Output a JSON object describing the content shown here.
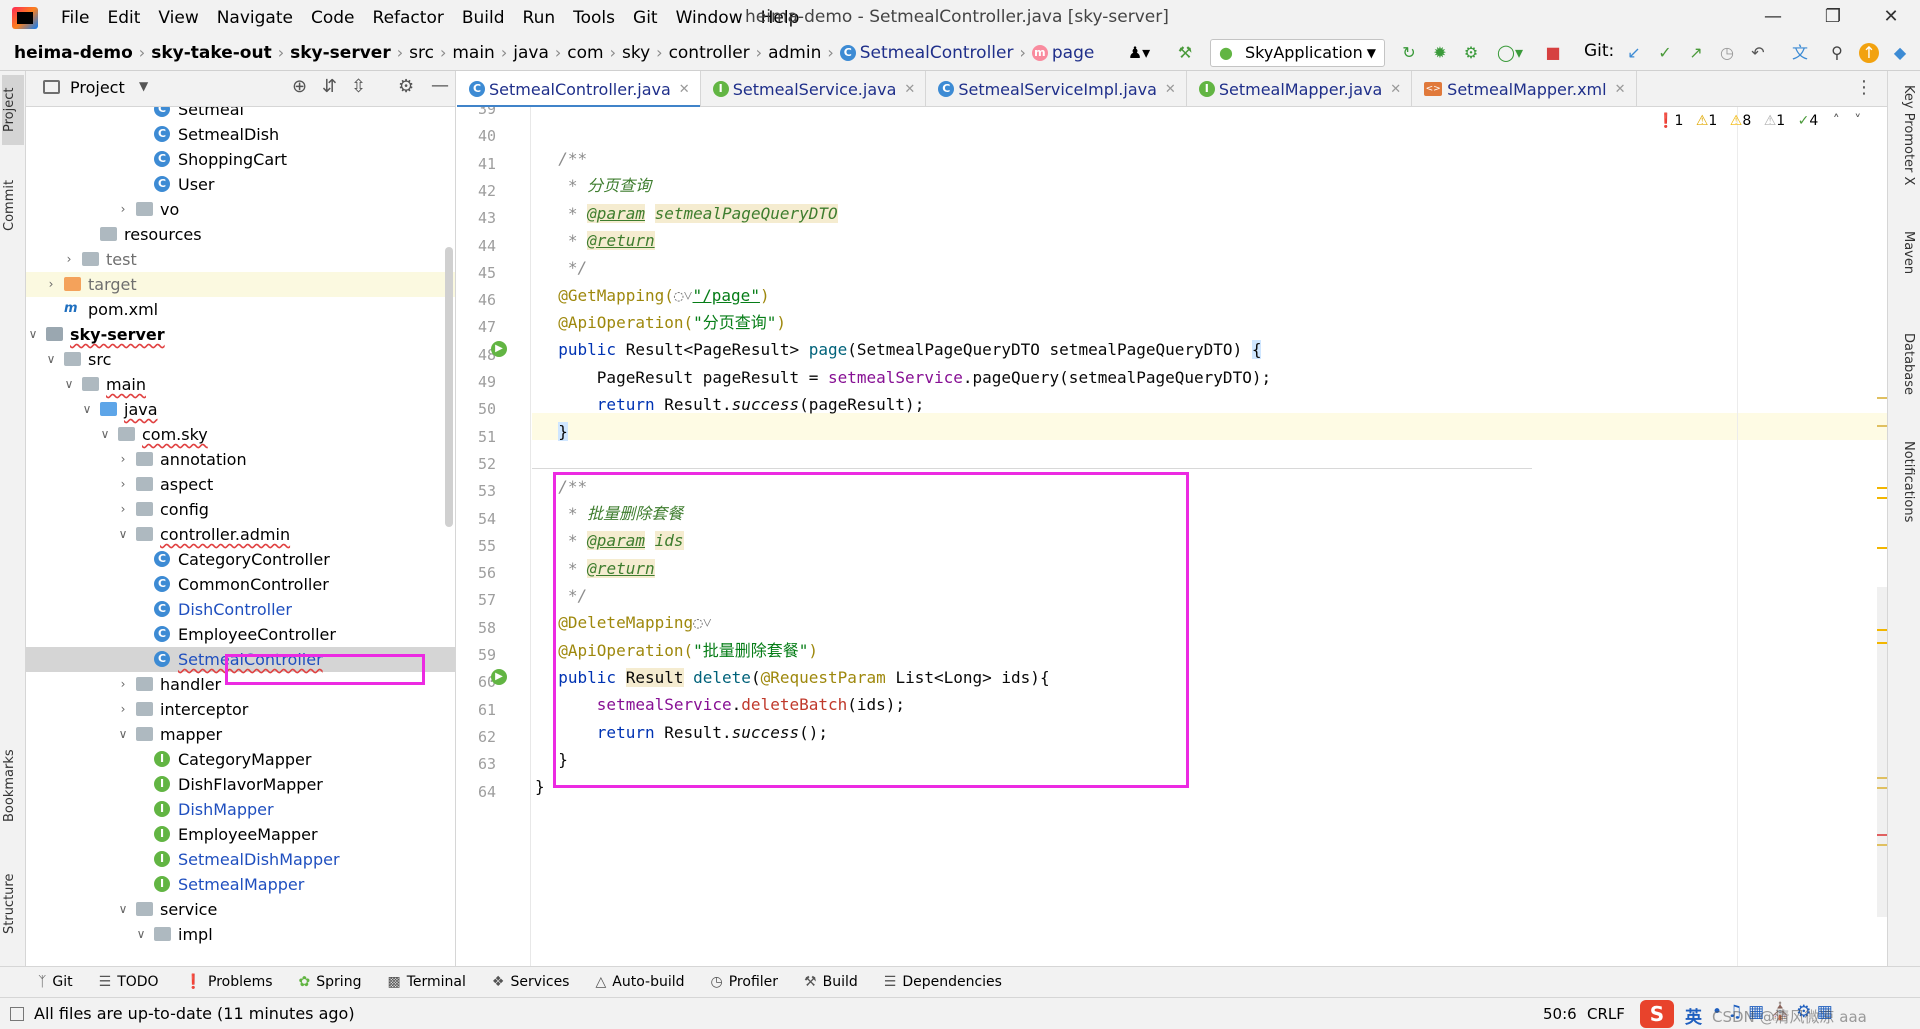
{
  "menu": [
    "File",
    "Edit",
    "View",
    "Navigate",
    "Code",
    "Refactor",
    "Build",
    "Run",
    "Tools",
    "Git",
    "Window",
    "Help"
  ],
  "window_title": "heima-demo - SetmealController.java [sky-server]",
  "breadcrumb": [
    "heima-demo",
    "sky-take-out",
    "sky-server",
    "src",
    "main",
    "java",
    "com",
    "sky",
    "controller",
    "admin",
    "SetmealController",
    "page"
  ],
  "run_config": "SkyApplication",
  "git_label": "Git:",
  "project_panel": {
    "title": "Project"
  },
  "tree": [
    {
      "label": "Setmeal",
      "icon": "class-icon",
      "depth": 9
    },
    {
      "label": "SetmealDish",
      "icon": "class-icon",
      "depth": 9
    },
    {
      "label": "ShoppingCart",
      "icon": "class-icon",
      "depth": 9
    },
    {
      "label": "User",
      "icon": "class-icon",
      "depth": 9
    },
    {
      "label": "vo",
      "icon": "package-icon",
      "depth": 8,
      "arrow": "right"
    },
    {
      "label": "resources",
      "icon": "folder-icon",
      "depth": 6
    },
    {
      "label": "test",
      "icon": "folder-icon",
      "depth": 5,
      "arrow": "right",
      "color": "gray"
    },
    {
      "label": "target",
      "icon": "folder-orange-icon",
      "depth": 4,
      "arrow": "right",
      "color": "gray",
      "hl": true
    },
    {
      "label": "pom.xml",
      "icon": "maven-icon",
      "depth": 4
    },
    {
      "label": "sky-server",
      "icon": "module-icon",
      "depth": 3,
      "arrow": "down",
      "bold": true,
      "squiggle": true
    },
    {
      "label": "src",
      "icon": "folder-icon",
      "depth": 4,
      "arrow": "down"
    },
    {
      "label": "main",
      "icon": "folder-icon",
      "depth": 5,
      "arrow": "down",
      "squiggle": true
    },
    {
      "label": "java",
      "icon": "folder-blue-icon",
      "depth": 6,
      "arrow": "down",
      "squiggle": true
    },
    {
      "label": "com.sky",
      "icon": "package-icon",
      "depth": 7,
      "arrow": "down",
      "squiggle": true
    },
    {
      "label": "annotation",
      "icon": "package-icon",
      "depth": 8,
      "arrow": "right"
    },
    {
      "label": "aspect",
      "icon": "package-icon",
      "depth": 8,
      "arrow": "right"
    },
    {
      "label": "config",
      "icon": "package-icon",
      "depth": 8,
      "arrow": "right"
    },
    {
      "label": "controller.admin",
      "icon": "package-icon",
      "depth": 8,
      "arrow": "down",
      "squiggle": true
    },
    {
      "label": "CategoryController",
      "icon": "class-icon",
      "depth": 9
    },
    {
      "label": "CommonController",
      "icon": "class-icon",
      "depth": 9
    },
    {
      "label": "DishController",
      "icon": "class-icon",
      "depth": 9,
      "color": "blue"
    },
    {
      "label": "EmployeeController",
      "icon": "class-icon",
      "depth": 9
    },
    {
      "label": "SetmealController",
      "icon": "class-icon",
      "depth": 9,
      "color": "blue",
      "selected": true,
      "squiggle": true
    },
    {
      "label": "handler",
      "icon": "package-icon",
      "depth": 8,
      "arrow": "right"
    },
    {
      "label": "interceptor",
      "icon": "package-icon",
      "depth": 8,
      "arrow": "right"
    },
    {
      "label": "mapper",
      "icon": "package-icon",
      "depth": 8,
      "arrow": "down"
    },
    {
      "label": "CategoryMapper",
      "icon": "interface-icon",
      "depth": 9
    },
    {
      "label": "DishFlavorMapper",
      "icon": "interface-icon",
      "depth": 9
    },
    {
      "label": "DishMapper",
      "icon": "interface-icon",
      "depth": 9,
      "color": "blue"
    },
    {
      "label": "EmployeeMapper",
      "icon": "interface-icon",
      "depth": 9
    },
    {
      "label": "SetmealDishMapper",
      "icon": "interface-icon",
      "depth": 9,
      "color": "blue"
    },
    {
      "label": "SetmealMapper",
      "icon": "interface-icon",
      "depth": 9,
      "color": "blue"
    },
    {
      "label": "service",
      "icon": "package-icon",
      "depth": 8,
      "arrow": "down"
    },
    {
      "label": "impl",
      "icon": "package-icon",
      "depth": 9,
      "arrow": "down"
    }
  ],
  "tabs": [
    {
      "label": "SetmealController.java",
      "icon": "class-icon",
      "active": true
    },
    {
      "label": "SetmealService.java",
      "icon": "interface-icon"
    },
    {
      "label": "SetmealServiceImpl.java",
      "icon": "class-icon"
    },
    {
      "label": "SetmealMapper.java",
      "icon": "interface-icon"
    },
    {
      "label": "SetmealMapper.xml",
      "icon": "xml-icon"
    }
  ],
  "inspections": {
    "errors": "1",
    "warnings_a": "1",
    "warnings_b": "8",
    "weak": "1",
    "ok": "4"
  },
  "line_numbers": [
    "39",
    "40",
    "41",
    "42",
    "43",
    "44",
    "45",
    "46",
    "47",
    "48",
    "49",
    "50",
    "51",
    "52",
    "53",
    "54",
    "55",
    "56",
    "57",
    "58",
    "59",
    "60",
    "61",
    "62",
    "63",
    "64"
  ],
  "code": {
    "l40": "/**",
    "l41_star": " * ",
    "l41_text": "分页查询",
    "l42_star": " * ",
    "l42_tag": "@param",
    "l42_name": "setmealPageQueryDTO",
    "l43_star": " * ",
    "l43_tag": "@return",
    "l44": " */",
    "l45_ann": "@GetMapping(",
    "l45_str": "\"/page\"",
    "l45_end": ")",
    "l46_ann": "@ApiOperation(",
    "l46_str": "\"分页查询\"",
    "l46_end": ")",
    "l47_kw": "public",
    "l47_a": " Result<PageResult> ",
    "l47_m": "page",
    "l47_b": "(SetmealPageQueryDTO setmealPageQueryDTO) ",
    "l47_brace": "{",
    "l48_a": "    PageResult pageResult = ",
    "l48_f": "setmealService",
    "l48_b": ".pageQuery(setmealPageQueryDTO);",
    "l49_kw": "    return",
    "l49_a": " Result.",
    "l49_m": "success",
    "l49_b": "(pageResult);",
    "l50": "}",
    "l52": "/**",
    "l53_star": " * ",
    "l53_text": "批量删除套餐",
    "l54_star": " * ",
    "l54_tag": "@param",
    "l54_name": "ids",
    "l55_star": " * ",
    "l55_tag": "@return",
    "l56": " */",
    "l57_ann": "@DeleteMapping",
    "l58_ann": "@ApiOperation(",
    "l58_str": "\"批量删除套餐\"",
    "l58_end": ")",
    "l59_kw": "public",
    "l59_sp": " ",
    "l59_type": "Result",
    "l59_m": " delete",
    "l59_p": "(",
    "l59_ann": "@RequestParam",
    "l59_b": " List<Long> ids){",
    "l60_f": "    setmealService",
    "l60_dot": ".",
    "l60_m": "deleteBatch",
    "l60_b": "(ids);",
    "l61_kw": "    return",
    "l61_a": " Result.",
    "l61_m": "success",
    "l61_b": "();",
    "l62": "}",
    "l63": "}"
  },
  "right_tools": [
    "Key Promoter X",
    "Maven",
    "Database",
    "Notifications"
  ],
  "left_tools": [
    "Project",
    "Commit",
    "Bookmarks",
    "Structure"
  ],
  "bottom_tabs": [
    "Git",
    "TODO",
    "Problems",
    "Spring",
    "Terminal",
    "Services",
    "Auto-build",
    "Profiler",
    "Build",
    "Dependencies"
  ],
  "status": {
    "message": "All files are up-to-date (11 minutes ago)",
    "position": "50:6",
    "line_sep": "CRLF",
    "ime": "英",
    "watermark": "CSDN @清风微凉 aaa"
  }
}
